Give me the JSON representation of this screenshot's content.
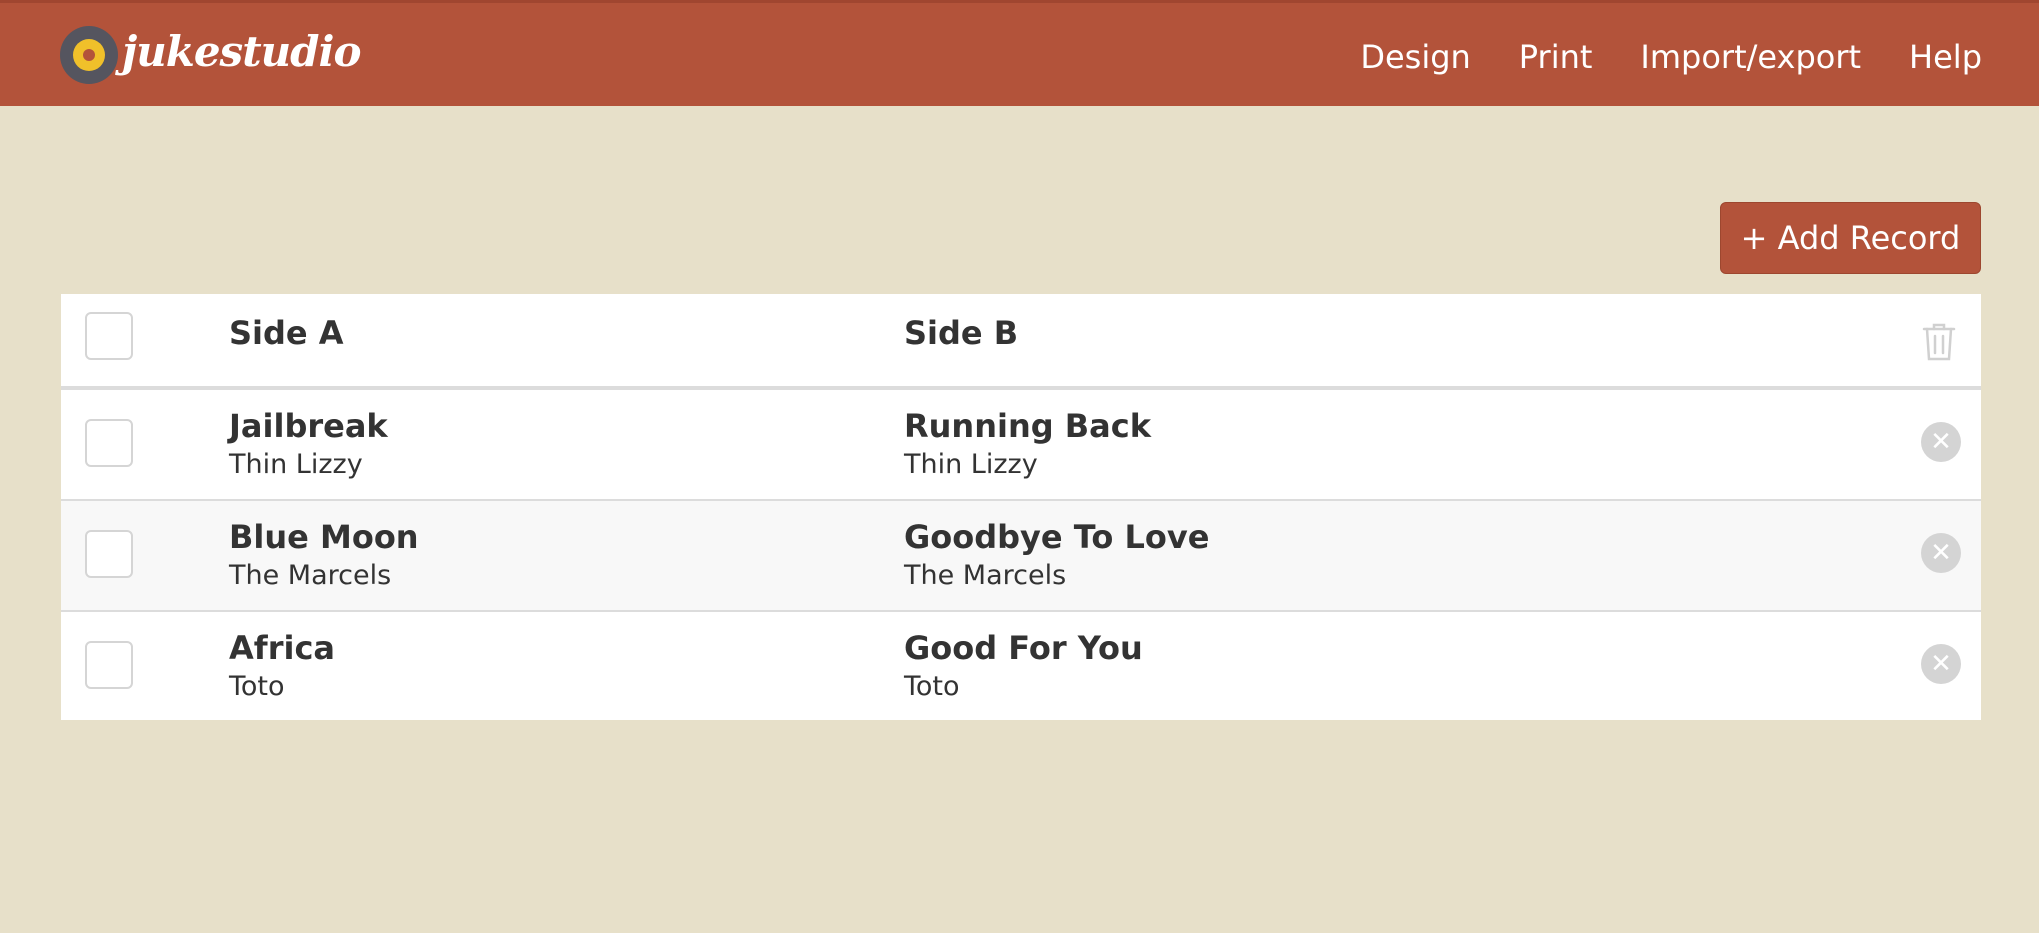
{
  "header": {
    "brand": "jukestudio",
    "nav": [
      "Design",
      "Print",
      "Import/export",
      "Help"
    ]
  },
  "toolbar": {
    "add_label": "+ Add Record"
  },
  "table": {
    "columns": [
      "Side A",
      "Side B"
    ],
    "rows": [
      {
        "side_a": {
          "title": "Jailbreak",
          "artist": "Thin Lizzy"
        },
        "side_b": {
          "title": "Running Back",
          "artist": "Thin Lizzy"
        }
      },
      {
        "side_a": {
          "title": "Blue Moon",
          "artist": "The Marcels"
        },
        "side_b": {
          "title": "Goodbye To Love",
          "artist": "The Marcels"
        }
      },
      {
        "side_a": {
          "title": "Africa",
          "artist": "Toto"
        },
        "side_b": {
          "title": "Good For You",
          "artist": "Toto"
        }
      }
    ]
  },
  "icons": {
    "logo": "record-disc-icon",
    "delete_all": "trash-icon",
    "remove_row": "close-circle-icon"
  },
  "colors": {
    "accent": "#b3533a",
    "background": "#e7e0c9",
    "table_bg": "#ffffff",
    "alt_row": "#f8f8f8"
  }
}
